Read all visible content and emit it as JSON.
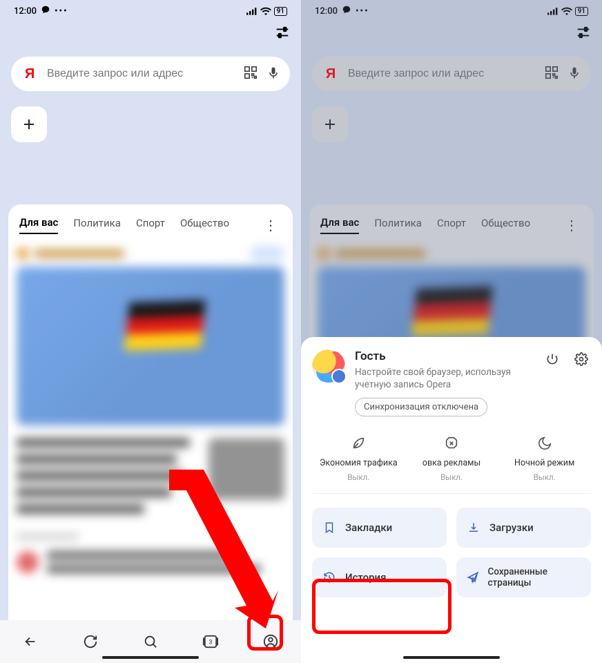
{
  "status": {
    "time": "12:00",
    "battery": "91"
  },
  "search": {
    "logo": "Я",
    "placeholder": "Введите запрос или адрес"
  },
  "tabs": {
    "t1": "Для вас",
    "t2": "Политика",
    "t3": "Спорт",
    "t4": "Общество"
  },
  "sheet": {
    "name": "Гость",
    "desc": "Настройте свой браузер, используя учетную запись Opera",
    "sync": "Синхронизация отключена"
  },
  "modes": {
    "m1_title": "Экономия трафика",
    "m1_state": "Выкл.",
    "m2_title": "овка рекламы",
    "m2_state": "Выкл.",
    "m3_title": "Ночной режим",
    "m3_state": "Выкл."
  },
  "tiles": {
    "bookmarks": "Закладки",
    "downloads": "Загрузки",
    "history": "История",
    "saved": "Сохраненные страницы"
  }
}
